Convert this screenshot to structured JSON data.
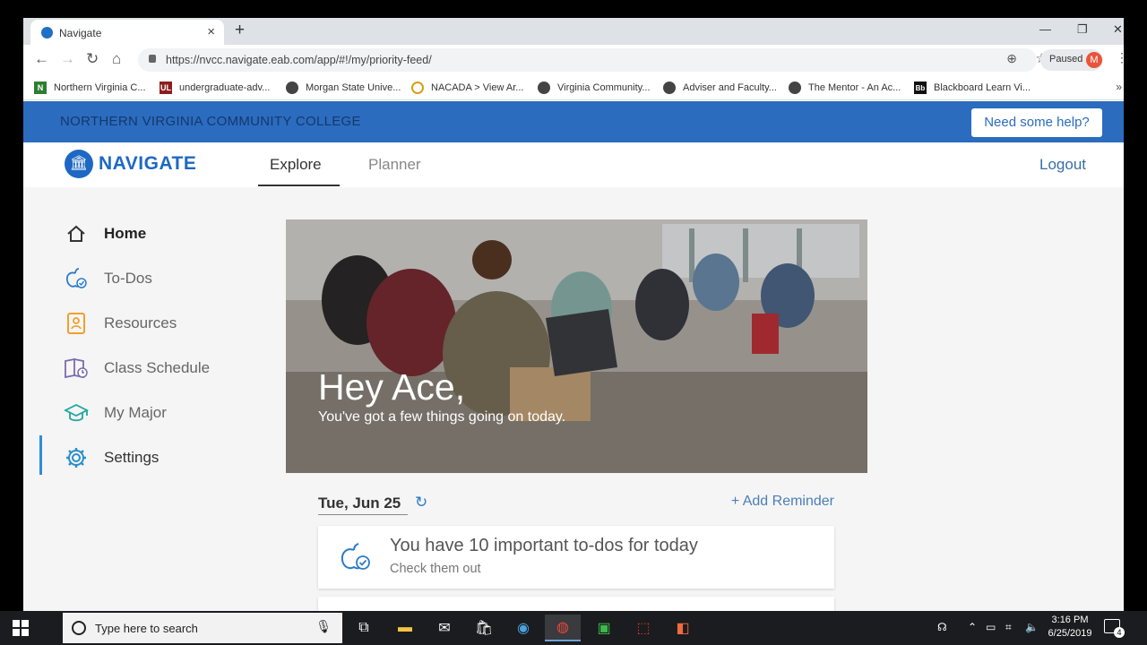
{
  "browser": {
    "tab_title": "Navigate",
    "url": "https://nvcc.navigate.eab.com/app/#!/my/priority-feed/",
    "profile_label": "Paused",
    "profile_initial": "M",
    "bookmarks": [
      {
        "label": "Northern Virginia C...",
        "icon": "N"
      },
      {
        "label": "undergraduate-adv...",
        "icon": "UL"
      },
      {
        "label": "Morgan State Unive...",
        "icon": "globe"
      },
      {
        "label": "NACADA > View Ar...",
        "icon": "circle"
      },
      {
        "label": "Virginia Community...",
        "icon": "globe"
      },
      {
        "label": "Adviser and Faculty...",
        "icon": "globe"
      },
      {
        "label": "The Mentor - An Ac...",
        "icon": "globe"
      },
      {
        "label": "Blackboard Learn Vi...",
        "icon": "Bb"
      }
    ]
  },
  "app": {
    "college_name": "NORTHERN VIRGINIA COMMUNITY COLLEGE",
    "help_button": "Need some help?",
    "logo_text": "NAVIGATE",
    "tabs": {
      "explore": "Explore",
      "planner": "Planner"
    },
    "logout": "Logout",
    "sidebar": [
      {
        "label": "Home",
        "icon": "home-icon"
      },
      {
        "label": "To-Dos",
        "icon": "todo-apple-icon"
      },
      {
        "label": "Resources",
        "icon": "address-book-icon"
      },
      {
        "label": "Class Schedule",
        "icon": "schedule-book-icon"
      },
      {
        "label": "My Major",
        "icon": "graduation-cap-icon"
      },
      {
        "label": "Settings",
        "icon": "gear-icon"
      }
    ],
    "hero": {
      "greeting": "Hey Ace,",
      "subtext": "You've got a few things going on today."
    },
    "feed": {
      "date": "Tue, Jun 25",
      "add_reminder": "+ Add Reminder",
      "card_title": "You have 10 important to-dos for today",
      "card_subtitle": "Check them out"
    }
  },
  "taskbar": {
    "search_placeholder": "Type here to search",
    "time": "3:16 PM",
    "date": "6/25/2019",
    "notification_count": "4"
  },
  "colors": {
    "banner": "#2b6cbf",
    "brand_blue": "#1e68c4",
    "active_indicator": "#2a8fd9"
  }
}
